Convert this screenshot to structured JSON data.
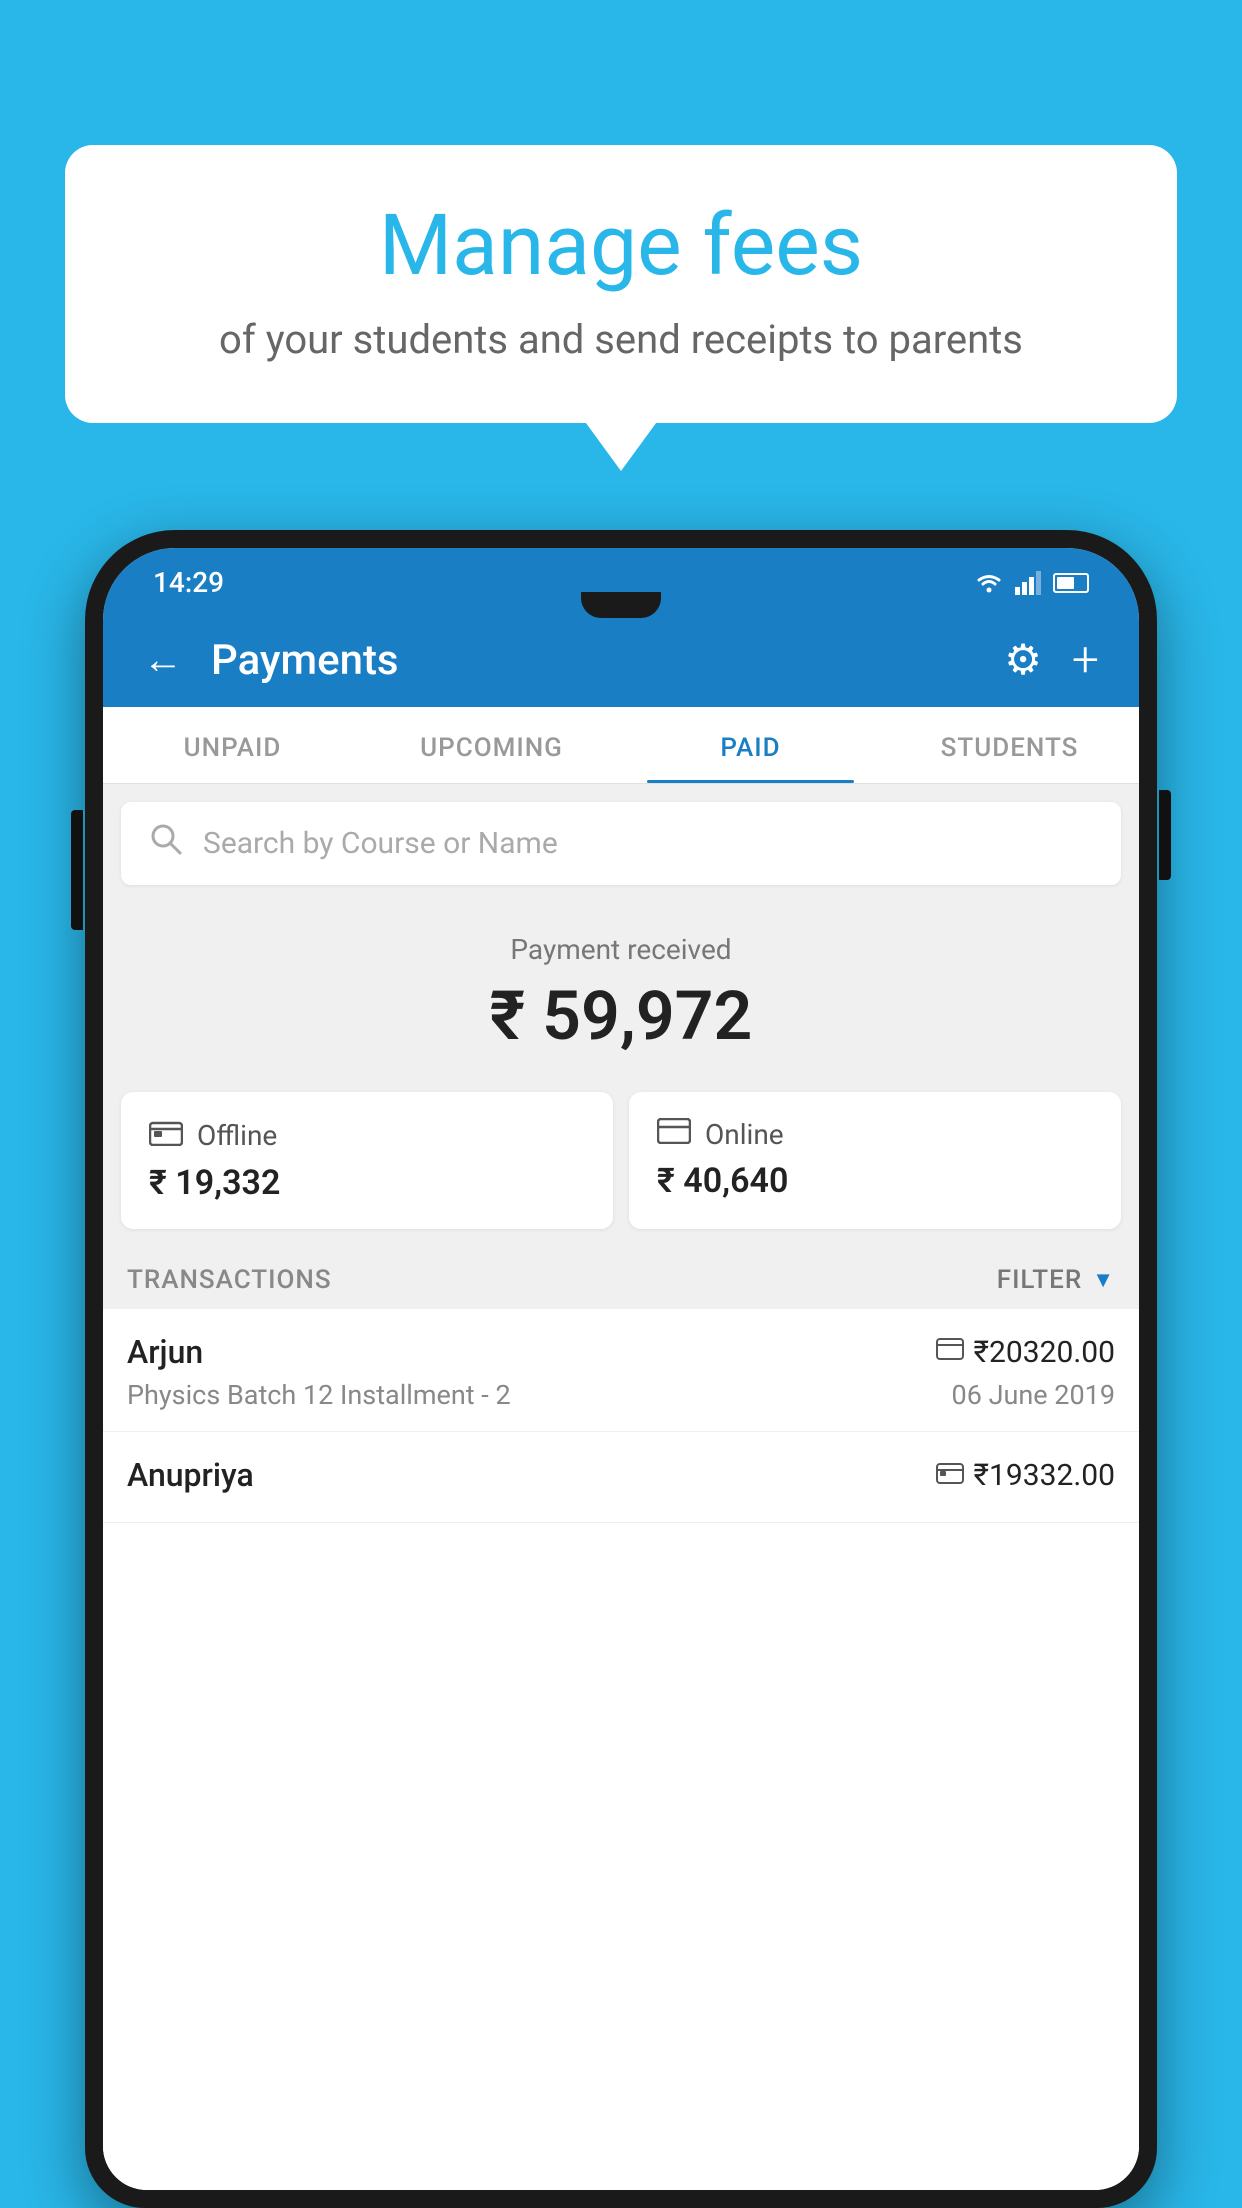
{
  "background_color": "#29b6e8",
  "bubble": {
    "title": "Manage fees",
    "subtitle": "of your students and send receipts to parents"
  },
  "status_bar": {
    "time": "14:29",
    "wifi_icon": "wifi",
    "signal_icon": "signal",
    "battery_icon": "battery"
  },
  "app_bar": {
    "back_label": "←",
    "title": "Payments",
    "gear_label": "⚙",
    "plus_label": "+"
  },
  "tabs": [
    {
      "label": "UNPAID",
      "active": false
    },
    {
      "label": "UPCOMING",
      "active": false
    },
    {
      "label": "PAID",
      "active": true
    },
    {
      "label": "STUDENTS",
      "active": false
    }
  ],
  "search": {
    "placeholder": "Search by Course or Name"
  },
  "payment_received": {
    "label": "Payment received",
    "amount": "₹ 59,972"
  },
  "payment_cards": [
    {
      "type": "Offline",
      "amount": "₹ 19,332",
      "icon": "💴"
    },
    {
      "type": "Online",
      "amount": "₹ 40,640",
      "icon": "💳"
    }
  ],
  "transactions": {
    "header_label": "TRANSACTIONS",
    "filter_label": "FILTER",
    "items": [
      {
        "name": "Arjun",
        "course": "Physics Batch 12 Installment - 2",
        "amount": "₹20320.00",
        "date": "06 June 2019",
        "payment_type": "card"
      },
      {
        "name": "Anupriya",
        "course": "",
        "amount": "₹19332.00",
        "date": "",
        "payment_type": "offline"
      }
    ]
  }
}
